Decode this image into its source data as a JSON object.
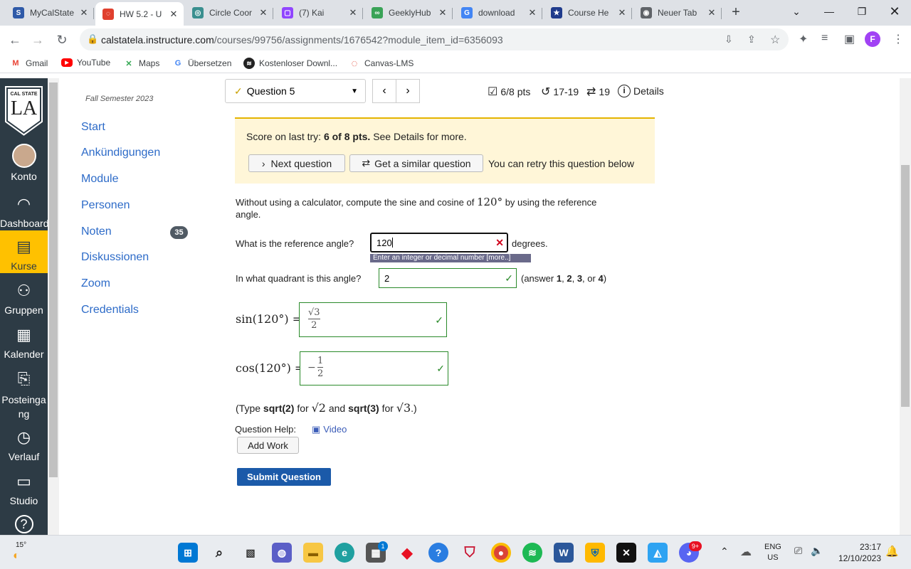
{
  "browser": {
    "tabs": [
      {
        "title": "MyCalState",
        "fav_text": "S",
        "fav_color": "#2f5aa8",
        "active": false
      },
      {
        "title": "HW 5.2 - U",
        "fav_text": "◌",
        "fav_color": "#e0402e",
        "active": true
      },
      {
        "title": "Circle Coor",
        "fav_text": "◎",
        "fav_color": "#3a8f8f",
        "active": false
      },
      {
        "title": "(7) Kai",
        "fav_text": "▢",
        "fav_color": "#9146ff",
        "active": false
      },
      {
        "title": "GeeklyHub",
        "fav_text": "∞",
        "fav_color": "#3aa357",
        "active": false
      },
      {
        "title": "download",
        "fav_text": "G",
        "fav_color": "#4285f4",
        "active": false
      },
      {
        "title": "Course He",
        "fav_text": "★",
        "fav_color": "#1f3b8c",
        "active": false
      },
      {
        "title": "Neuer Tab",
        "fav_text": "◉",
        "fav_color": "#5f6368",
        "active": false
      }
    ],
    "new_tab": "+",
    "url_host": "calstatela.instructure.com",
    "url_path": "/courses/99756/assignments/1676542?module_item_id=6356093",
    "profile_initial": "F",
    "bookmarks": [
      "Gmail",
      "YouTube",
      "Maps",
      "Übersetzen",
      "Kostenloser Downl...",
      "Canvas-LMS"
    ]
  },
  "canvas_nav": {
    "logo_top": "CAL STATE",
    "logo_main": "LA",
    "items": [
      "Konto",
      "Dashboard",
      "Kurse",
      "Gruppen",
      "Kalender",
      "Posteinga ng",
      "Verlauf",
      "Studio"
    ]
  },
  "course_nav": {
    "semester": "Fall Semester 2023",
    "items": [
      "Start",
      "Ankündigungen",
      "Module",
      "Personen",
      "Noten",
      "Diskussionen",
      "Zoom",
      "Credentials"
    ],
    "grades_badge": "35"
  },
  "question": {
    "selector_label": "Question 5",
    "stats": {
      "pts": "6/8 pts",
      "tries": "17-19",
      "retries": "19",
      "details": "Details"
    },
    "score_prefix": "Score on last try:",
    "score_bold": "6 of 8 pts.",
    "score_suffix": "See Details for more.",
    "next_button": "Next question",
    "similar_button": "Get a similar question",
    "retry_note": "You can retry this question below",
    "prompt_a": "Without using a calculator, compute the sine and cosine of",
    "prompt_math": "120°",
    "prompt_b": "by using the reference",
    "prompt_c": "angle.",
    "ref_label": "What is the reference angle?",
    "ref_value": "120",
    "ref_unit": "degrees.",
    "ref_hint": "Enter an integer or decimal number [more..]",
    "quad_label": "In what quadrant is this angle?",
    "quad_value": "2",
    "quad_note_a": "(answer",
    "quad_opts": [
      "1",
      "2",
      "3",
      "4"
    ],
    "sin_label": "sin(120°) =",
    "sin_num": "√3",
    "sin_den": "2",
    "cos_label": "cos(120°) =",
    "cos_sign": "−",
    "cos_num": "1",
    "cos_den": "2",
    "type_a": "(Type",
    "type_b": "sqrt(2)",
    "type_c": "for",
    "type_d": "√2",
    "type_e": "and",
    "type_f": "sqrt(3)",
    "type_g": "for",
    "type_h": "√3",
    "type_i": ".)",
    "help_label": "Question Help:",
    "help_video": "Video",
    "add_work": "Add Work",
    "submit": "Submit Question"
  },
  "taskbar": {
    "weather": "15°",
    "lang_a": "ENG",
    "lang_b": "US",
    "time": "23:17",
    "date": "12/10/2023",
    "discord_badge": "9+",
    "teams_badge": "1"
  }
}
